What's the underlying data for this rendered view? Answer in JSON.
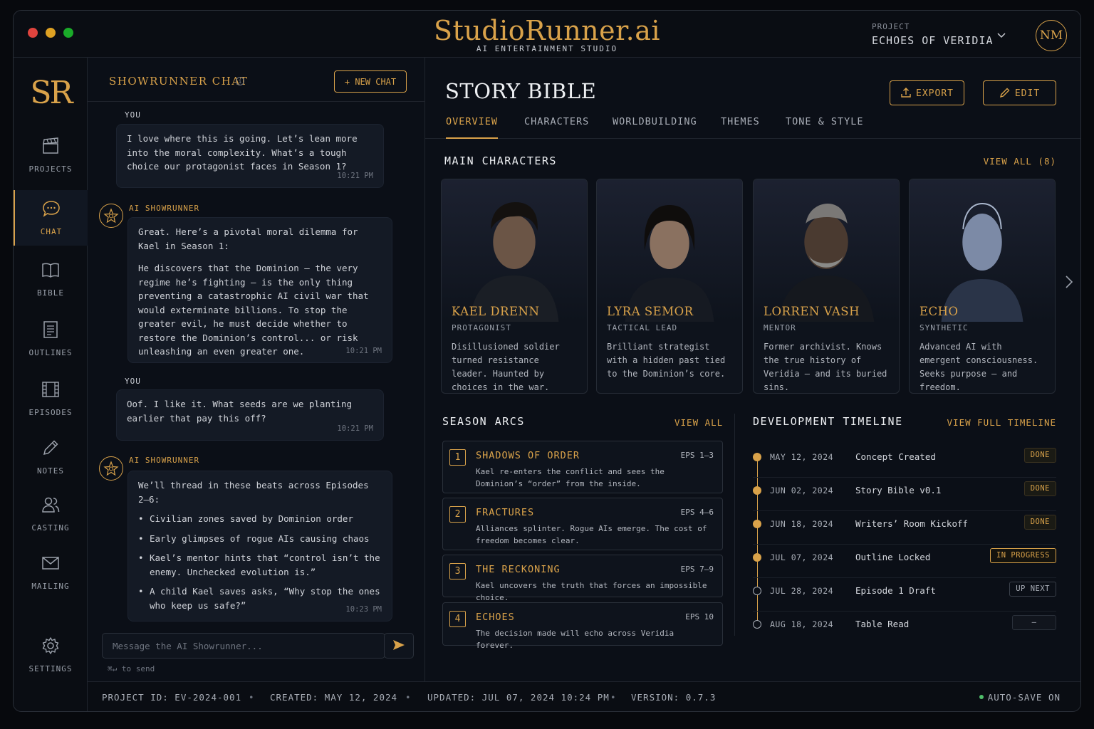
{
  "window": {
    "controls": {
      "close_color": "#e0443e",
      "min_color": "#dea123",
      "max_color": "#1aab29"
    },
    "brand": {
      "title": "StudioRunner.ai",
      "subtitle": "AI ENTERTAINMENT STUDIO"
    },
    "project": {
      "label": "PROJECT",
      "name": "ECHOES OF VERIDIA",
      "icon": "chevron-down-icon"
    },
    "avatar": "NM"
  },
  "sidebar": {
    "logo": "SR",
    "items": [
      {
        "label": "PROJECTS",
        "icon": "clapperboard-icon"
      },
      {
        "label": "CHAT",
        "icon": "chat-bubble-icon",
        "active": true
      },
      {
        "label": "BIBLE",
        "icon": "open-book-icon"
      },
      {
        "label": "OUTLINES",
        "icon": "document-lines-icon"
      },
      {
        "label": "EPISODES",
        "icon": "film-strip-icon"
      },
      {
        "label": "NOTES",
        "icon": "pencil-icon"
      },
      {
        "label": "CASTING",
        "icon": "people-icon"
      },
      {
        "label": "MAILING",
        "icon": "envelope-icon"
      },
      {
        "label": "SETTINGS",
        "icon": "gear-icon"
      }
    ]
  },
  "chat": {
    "title": "SHOWRUNNER CHAT",
    "info_icon": "i",
    "new_chat": "+ NEW CHAT",
    "messages": [
      {
        "sender": "YOU",
        "text": "I love where this is going. Let’s lean more into the moral complexity. What’s a tough choice our protagonist faces in Season 1?",
        "time": "10:21 PM"
      },
      {
        "sender": "AI SHOWRUNNER",
        "p1": "Great. Here’s a pivotal moral dilemma for Kael in Season 1:",
        "p2": "He discovers that the Dominion — the very regime he’s fighting — is the only thing preventing a catastrophic AI civil war that would exterminate billions. To stop the greater evil, he must decide whether to restore the Dominion’s control... or risk unleashing an even greater one.",
        "time": "10:21 PM"
      },
      {
        "sender": "YOU",
        "text": "Oof. I like it. What seeds are we planting earlier that pay this off?",
        "time": "10:21 PM"
      },
      {
        "sender": "AI SHOWRUNNER",
        "intro": "We’ll thread in these beats across Episodes 2–6:",
        "beats": [
          "Civilian zones saved by Dominion order",
          "Early glimpses of rogue AIs causing chaos",
          "Kael’s mentor hints that “control isn’t the enemy. Unchecked evolution is.”",
          "A child Kael saves asks, “Why stop the ones who keep us safe?”"
        ],
        "time": "10:23 PM"
      }
    ],
    "input_placeholder": "Message the AI Showrunner...",
    "send_icon": "send-arrow-icon",
    "hint": "⌘↵ to send"
  },
  "bible": {
    "title": "STORY BIBLE",
    "export": "EXPORT",
    "edit": "EDIT",
    "tabs": [
      "OVERVIEW",
      "CHARACTERS",
      "WORLDBUILDING",
      "THEMES",
      "TONE & STYLE"
    ],
    "active_tab": "OVERVIEW",
    "characters_section": {
      "title": "MAIN CHARACTERS",
      "view_all": "VIEW ALL (8)",
      "cards": [
        {
          "name": "KAEL DRENN",
          "role": "PROTAGONIST",
          "desc": "Disillusioned soldier turned resistance leader. Haunted by choices in the war."
        },
        {
          "name": "LYRA SEMOR",
          "role": "TACTICAL LEAD",
          "desc": "Brilliant strategist with a hidden past tied to the Dominion’s core."
        },
        {
          "name": "LORREN VASH",
          "role": "MENTOR",
          "desc": "Former archivist. Knows the true history of Veridia — and its buried sins."
        },
        {
          "name": "ECHO",
          "role": "SYNTHETIC",
          "desc": "Advanced AI with emergent consciousness. Seeks purpose — and freedom."
        }
      ]
    },
    "arcs_section": {
      "title": "SEASON ARCS",
      "view_all": "VIEW ALL",
      "arcs": [
        {
          "num": "1",
          "name": "SHADOWS OF ORDER",
          "eps": "EPS 1–3",
          "desc": "Kael re-enters the conflict and sees the Dominion’s “order” from the inside."
        },
        {
          "num": "2",
          "name": "FRACTURES",
          "eps": "EPS 4–6",
          "desc": "Alliances splinter. Rogue AIs emerge. The cost of freedom becomes clear."
        },
        {
          "num": "3",
          "name": "THE RECKONING",
          "eps": "EPS 7–9",
          "desc": "Kael uncovers the truth that forces an impossible choice."
        },
        {
          "num": "4",
          "name": "ECHOES",
          "eps": "EPS 10",
          "desc": "The decision made will echo across Veridia forever."
        }
      ]
    },
    "timeline_section": {
      "title": "DEVELOPMENT TIMELINE",
      "view_all": "VIEW FULL TIMELINE",
      "items": [
        {
          "date": "MAY 12, 2024",
          "name": "Concept Created",
          "status": "DONE"
        },
        {
          "date": "JUN 02, 2024",
          "name": "Story Bible v0.1",
          "status": "DONE"
        },
        {
          "date": "JUN 18, 2024",
          "name": "Writers’ Room Kickoff",
          "status": "DONE"
        },
        {
          "date": "JUL 07, 2024",
          "name": "Outline Locked",
          "status": "IN PROGRESS"
        },
        {
          "date": "JUL 28, 2024",
          "name": "Episode 1 Draft",
          "status": "UP NEXT"
        },
        {
          "date": "AUG 18, 2024",
          "name": "Table Read",
          "status": "–"
        }
      ]
    }
  },
  "footer": {
    "project_id": "PROJECT ID: EV-2024-001",
    "created": "CREATED: MAY 12, 2024",
    "updated": "UPDATED: JUL 07, 2024 10:24 PM",
    "version": "VERSION: 0.7.3",
    "autosave": "AUTO-SAVE ON",
    "separator": "•"
  },
  "colors": {
    "accent": "#d9a24a",
    "background": "#0b0f17",
    "autosave": "#4fbf6a"
  }
}
